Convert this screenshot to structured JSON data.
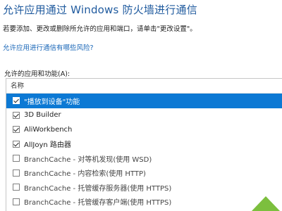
{
  "header": {
    "title": "允许应用通过 Windows 防火墙进行通信",
    "subtitle": "若要添加、更改或删除所允许的应用和端口，请单击\"更改设置\"。",
    "risk_link": "允许应用进行通信有哪些风险?"
  },
  "apps": {
    "group_label": "允许的应用和功能(A):",
    "column_name": "名称",
    "items": [
      {
        "label": "\"播放到设备\"功能",
        "checked": true,
        "selected": true
      },
      {
        "label": "3D Builder",
        "checked": true,
        "selected": false
      },
      {
        "label": "AliWorkbench",
        "checked": true,
        "selected": false
      },
      {
        "label": "AllJoyn 路由器",
        "checked": true,
        "selected": false
      },
      {
        "label": "BranchCache - 对等机发现(使用 WSD)",
        "checked": false,
        "selected": false
      },
      {
        "label": "BranchCache - 内容检索(使用 HTTP)",
        "checked": false,
        "selected": false
      },
      {
        "label": "BranchCache - 托管缓存服务器(使用 HTTPS)",
        "checked": false,
        "selected": false
      },
      {
        "label": "BranchCache - 托管缓存客户端(使用 HTTPS)",
        "checked": false,
        "selected": false
      }
    ]
  },
  "colors": {
    "title": "#1f5a9e",
    "link": "#1a67b8",
    "selection": "#0c79d4",
    "corner_accent": "#7cbf3e"
  }
}
